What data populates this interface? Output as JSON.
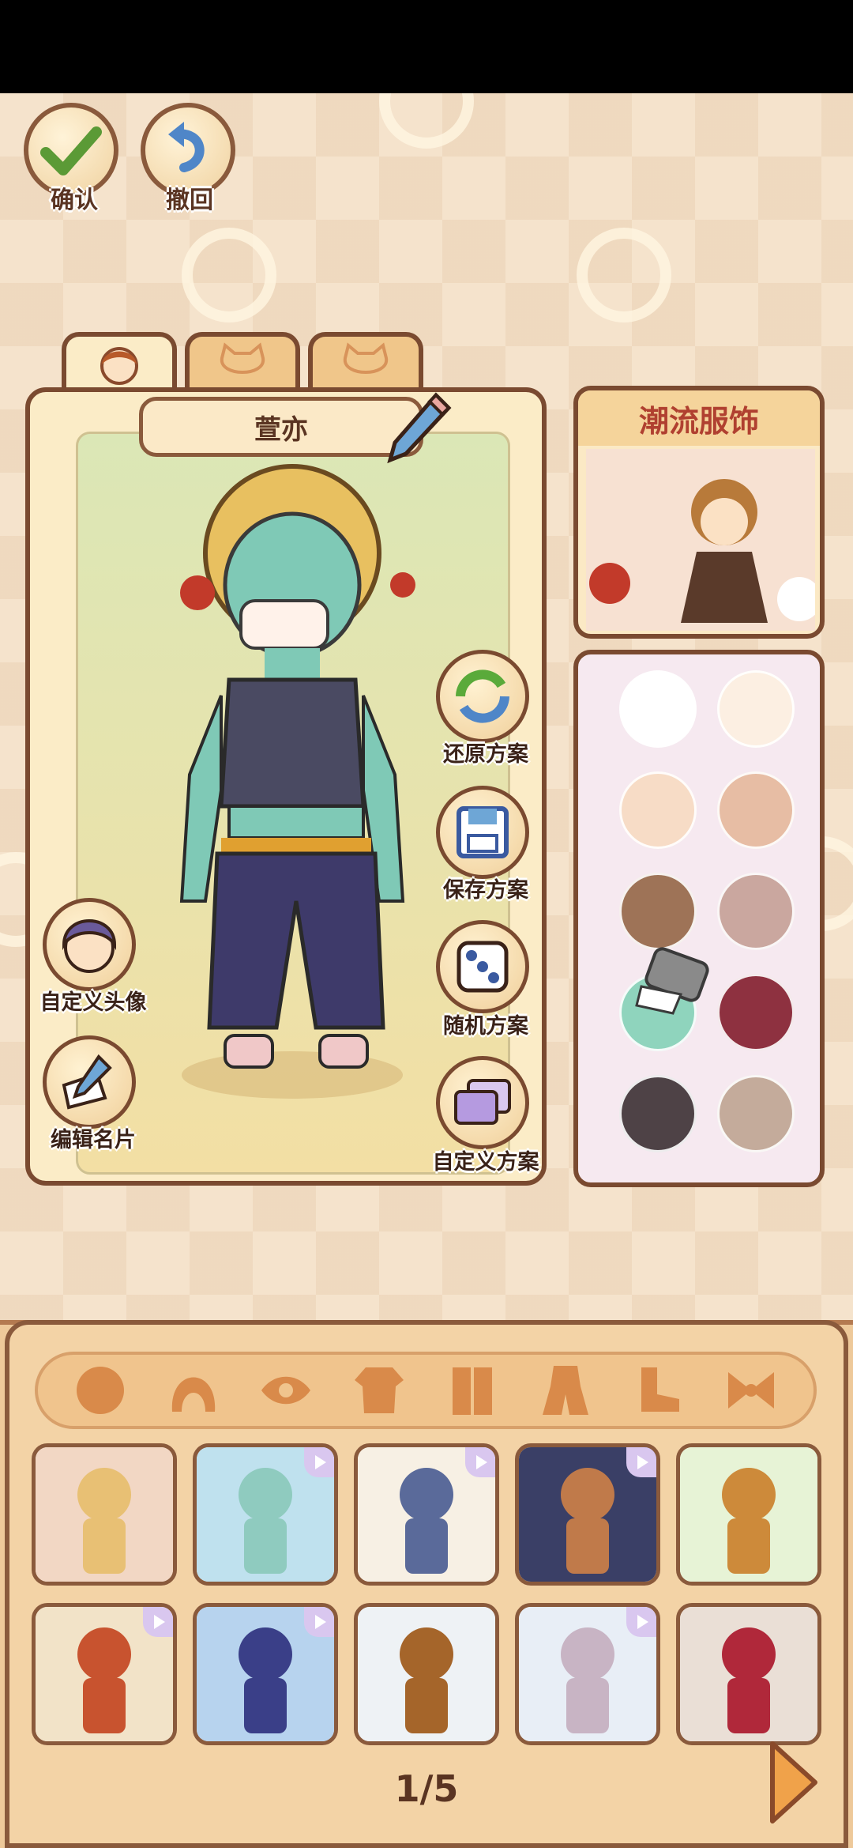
{
  "toolbar": {
    "confirm_label": "确认",
    "undo_label": "撤回"
  },
  "character": {
    "name": "萱亦"
  },
  "tabs": [
    {
      "icon": "person-head-icon",
      "active": true
    },
    {
      "icon": "cat-face-icon",
      "active": false
    },
    {
      "icon": "cat-face-icon",
      "active": false
    }
  ],
  "actions": {
    "restore_label": "还原方案",
    "save_label": "保存方案",
    "random_label": "随机方案",
    "custom_label": "自定义方案",
    "avatar_label": "自定义头像",
    "edit_card_label": "编辑名片"
  },
  "shop": {
    "title": "潮流服饰"
  },
  "palette": {
    "colors": [
      "#ffffff",
      "#fcefe2",
      "#f7dcc6",
      "#e7bda4",
      "#9e7357",
      "#caa79f",
      "#8fd4bd",
      "#8e3140",
      "#4e4246",
      "#c4ab9b"
    ]
  },
  "categories": [
    "face-icon",
    "hair-icon",
    "eye-icon",
    "top-icon",
    "coat-icon",
    "outfit-icon",
    "shoe-icon",
    "bow-icon"
  ],
  "outfits": [
    {
      "bg": "#f2d7c4",
      "accent": "#e8c074",
      "badge": false
    },
    {
      "bg": "#bfe1ee",
      "accent": "#8fcbbf",
      "badge": true
    },
    {
      "bg": "#f7f0e4",
      "accent": "#5a6a9a",
      "badge": true
    },
    {
      "bg": "#3a3f66",
      "accent": "#c07a4a",
      "badge": true
    },
    {
      "bg": "#e7f3d6",
      "accent": "#cd8a3a",
      "badge": false
    },
    {
      "bg": "#f2e3c8",
      "accent": "#c8532f",
      "badge": true
    },
    {
      "bg": "#b7d3ee",
      "accent": "#3a3f88",
      "badge": true
    },
    {
      "bg": "#eef2f5",
      "accent": "#a5652a",
      "badge": false
    },
    {
      "bg": "#e8eef6",
      "accent": "#c8b4c4",
      "badge": true
    },
    {
      "bg": "#eadfd6",
      "accent": "#b0283a",
      "badge": false
    }
  ],
  "pagination": {
    "text": "1/5"
  }
}
